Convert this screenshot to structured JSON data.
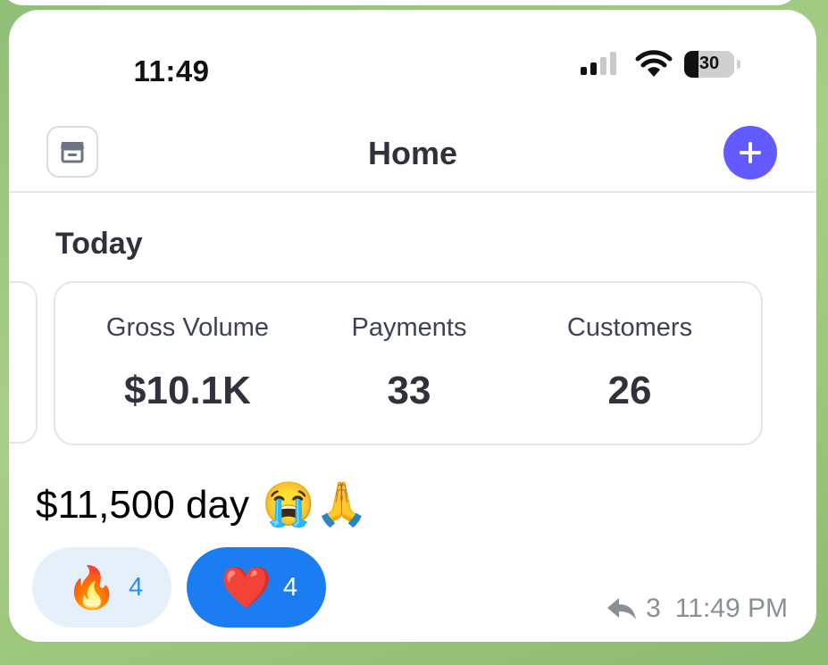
{
  "status_bar": {
    "time": "11:49",
    "battery": "30",
    "icons": [
      "signal-icon",
      "wifi-icon",
      "battery-icon"
    ]
  },
  "nav": {
    "title": "Home",
    "left_icon": "storefront-icon",
    "right_icon": "plus-icon"
  },
  "today": {
    "title": "Today",
    "metrics": [
      {
        "label": "Gross Volume",
        "value": "$10.1K"
      },
      {
        "label": "Payments",
        "value": "33"
      },
      {
        "label": "Customers",
        "value": "26"
      }
    ]
  },
  "message": {
    "text": "$11,500 day",
    "emojis": "😭🙏",
    "reactions": [
      {
        "emoji": "🔥",
        "count": "4"
      },
      {
        "emoji": "❤️",
        "count": "4"
      }
    ],
    "reply_count": "3",
    "timestamp": "11:49 PM"
  },
  "colors": {
    "accent": "#635bff",
    "text_dark": "#30313d",
    "reaction_active": "#1c7cf2",
    "reaction_inactive": "#e6f0fb",
    "chat_background": "#a9cf86"
  }
}
